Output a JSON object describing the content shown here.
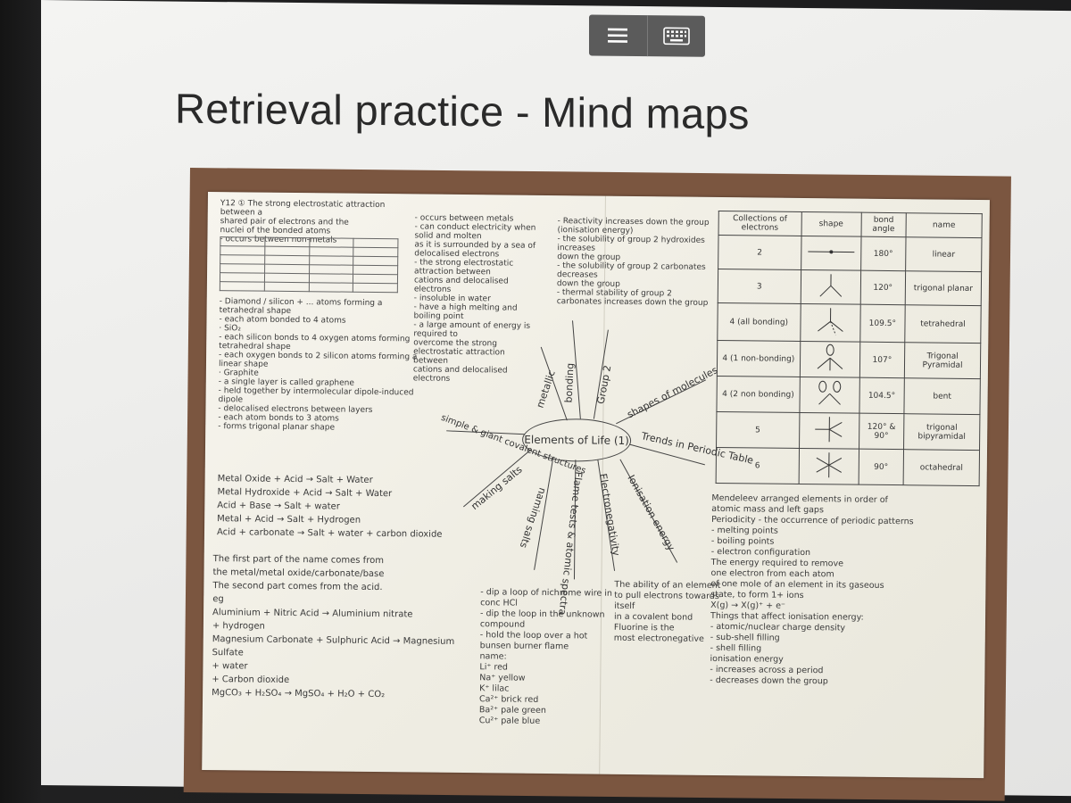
{
  "toolbar": {
    "menu_icon": "hamburger-menu-icon",
    "keyboard_icon": "keyboard-icon"
  },
  "slide": {
    "title": "Retrieval practice - Mind maps"
  },
  "mindmap": {
    "center": "Elements of Life (1)",
    "branches": [
      {
        "label": "metallic"
      },
      {
        "label": "bonding"
      },
      {
        "label": "Group 2"
      },
      {
        "label": "shapes of molecules"
      },
      {
        "label": "Trends in Periodic Table"
      },
      {
        "label": "Ionisation energy"
      },
      {
        "label": "Electronegativity"
      },
      {
        "label": "Flame tests & atomic spectra"
      },
      {
        "label": "naming salts"
      },
      {
        "label": "making salts"
      },
      {
        "label": "simple & giant covalent structures"
      }
    ],
    "notes": {
      "top_left": [
        "Y12 ① The strong electrostatic attraction between a",
        "shared pair of electrons and the",
        "nuclei of the bonded atoms",
        "- occurs between non-metals"
      ],
      "giant": [
        "- Diamond / silicon + ... atoms forming a tetrahedral shape",
        "- each atom bonded to 4 atoms",
        "· SiO₂",
        "- each silicon bonds to 4 oxygen atoms forming tetrahedral shape",
        "- each oxygen bonds to 2 silicon atoms forming a linear shape",
        "· Graphite",
        "- a single layer is called graphene",
        "- held together by intermolecular dipole-induced dipole",
        "- delocalised electrons between layers",
        "- each atom bonds to 3 atoms",
        "- forms trigonal planar shape"
      ],
      "salts": [
        "Metal Oxide + Acid → Salt + Water",
        "Metal Hydroxide + Acid → Salt + Water",
        "Acid + Base → Salt + water",
        "Metal + Acid → Salt + Hydrogen",
        "Acid + carbonate → Salt + water + carbon dioxide"
      ],
      "naming": [
        "The first part of the name comes from",
        "the metal/metal oxide/carbonate/base",
        "The second part comes from the acid.",
        "eg",
        "Aluminium + Nitric Acid → Aluminium nitrate",
        "+ hydrogen",
        "Magnesium Carbonate + Sulphuric Acid → Magnesium Sulfate",
        "+ water",
        "+ Carbon dioxide",
        "MgCO₃ + H₂SO₄ → MgSO₄ + H₂O + CO₂"
      ],
      "metallic": [
        "- occurs between metals",
        "- can conduct electricity when solid and molten",
        "as it is surrounded by a sea of delocalised electrons",
        "- the strong electrostatic attraction between",
        "cations and delocalised electrons",
        "- insoluble in water",
        "- have a high melting and boiling point",
        "- a large amount of energy is required to",
        "overcome the strong electrostatic attraction between",
        "cations and delocalised electrons"
      ],
      "group2": [
        "- Reactivity increases down the group",
        "(ionisation energy)",
        "- the solubility of group 2 hydroxides increases",
        "down the group",
        "- the solubility of group 2 carbonates decreases",
        "down the group",
        "- thermal stability of group 2",
        "carbonates increases down the group"
      ],
      "flame": [
        "- dip a loop of nichrome wire in conc HCl",
        "- dip the loop in the unknown compound",
        "- hold the loop over a hot bunsen burner flame",
        "name:",
        "Li⁺ red",
        "Na⁺ yellow",
        "K⁺ lilac",
        "Ca²⁺ brick red",
        "Ba²⁺ pale green",
        "Cu²⁺ pale blue"
      ],
      "electroneg": [
        "The ability of an element",
        "to pull electrons towards itself",
        "in a covalent bond",
        "Fluorine is the",
        "most electronegative"
      ],
      "trends": [
        "Mendeleev arranged elements in order of",
        "atomic mass and left gaps",
        "Periodicity - the occurrence of periodic patterns",
        "- melting points",
        "- boiling points",
        "- electron configuration",
        "The energy required to remove",
        "one electron from each atom",
        "of one mole of an element in its gaseous",
        "state, to form 1+ ions",
        "X(g) → X(g)⁺ + e⁻",
        "Things that affect ionisation energy:",
        "- atomic/nuclear charge density",
        "- sub-shell filling",
        "- shell filling",
        "ionisation energy",
        "- increases across a period",
        "- decreases down the group"
      ]
    },
    "shape_table": {
      "headers": [
        "Collections of electrons",
        "shape",
        "bond angle",
        "name"
      ],
      "rows": [
        {
          "electrons": "2",
          "angle": "180°",
          "name": "linear"
        },
        {
          "electrons": "3",
          "angle": "120°",
          "name": "trigonal planar"
        },
        {
          "electrons": "4 (all bonding)",
          "angle": "109.5°",
          "name": "tetrahedral"
        },
        {
          "electrons": "4 (1 non-bonding)",
          "angle": "107°",
          "name": "Trigonal Pyramidal"
        },
        {
          "electrons": "4 (2 non bonding)",
          "angle": "104.5°",
          "name": "bent"
        },
        {
          "electrons": "5",
          "angle": "120° & 90°",
          "name": "trigonal bipyramidal"
        },
        {
          "electrons": "6",
          "angle": "90°",
          "name": "octahedral"
        }
      ]
    }
  }
}
